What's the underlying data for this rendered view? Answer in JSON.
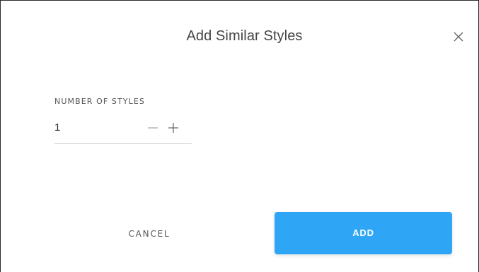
{
  "dialog": {
    "title": "Add Similar Styles",
    "close_icon": "close-icon"
  },
  "number_of_styles": {
    "label": "NUMBER OF STYLES",
    "value": "1",
    "decrement_icon": "minus-icon",
    "increment_icon": "plus-icon"
  },
  "actions": {
    "cancel_label": "CANCEL",
    "add_label": "ADD"
  },
  "colors": {
    "accent": "#2fa6f5",
    "title_text": "#444444",
    "underline": "#cfcfcf"
  }
}
